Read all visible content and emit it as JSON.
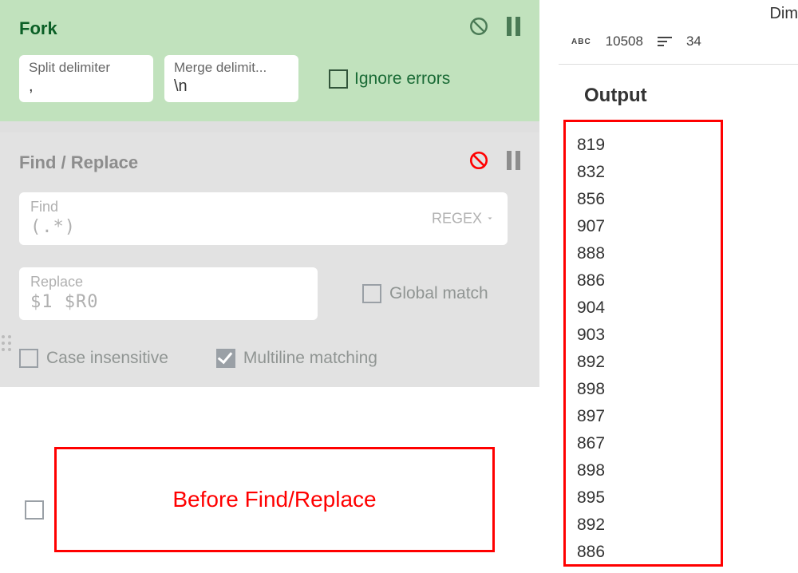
{
  "fork": {
    "title": "Fork",
    "split_label": "Split delimiter",
    "split_value": ",",
    "merge_label": "Merge delimit...",
    "merge_value": "\\n",
    "ignore_label": "Ignore errors"
  },
  "find_replace": {
    "title": "Find / Replace",
    "find_label": "Find",
    "find_value": "(.*)",
    "regex_label": "REGEX",
    "replace_label": "Replace",
    "replace_value": "$1 $R0",
    "global_label": "Global match",
    "case_label": "Case insensitive",
    "multi_label": "Multiline matching"
  },
  "annotation": {
    "text": "Before Find/Replace"
  },
  "right": {
    "dim_header": "Dim",
    "abc_badge": "ABC",
    "char_count": "10508",
    "line_count": "34",
    "output_title": "Output",
    "lines": [
      "819",
      "832",
      "856",
      "907",
      "888",
      "886",
      "904",
      "903",
      "892",
      "898",
      "897",
      "867",
      "898",
      "895",
      "892",
      "886"
    ]
  }
}
